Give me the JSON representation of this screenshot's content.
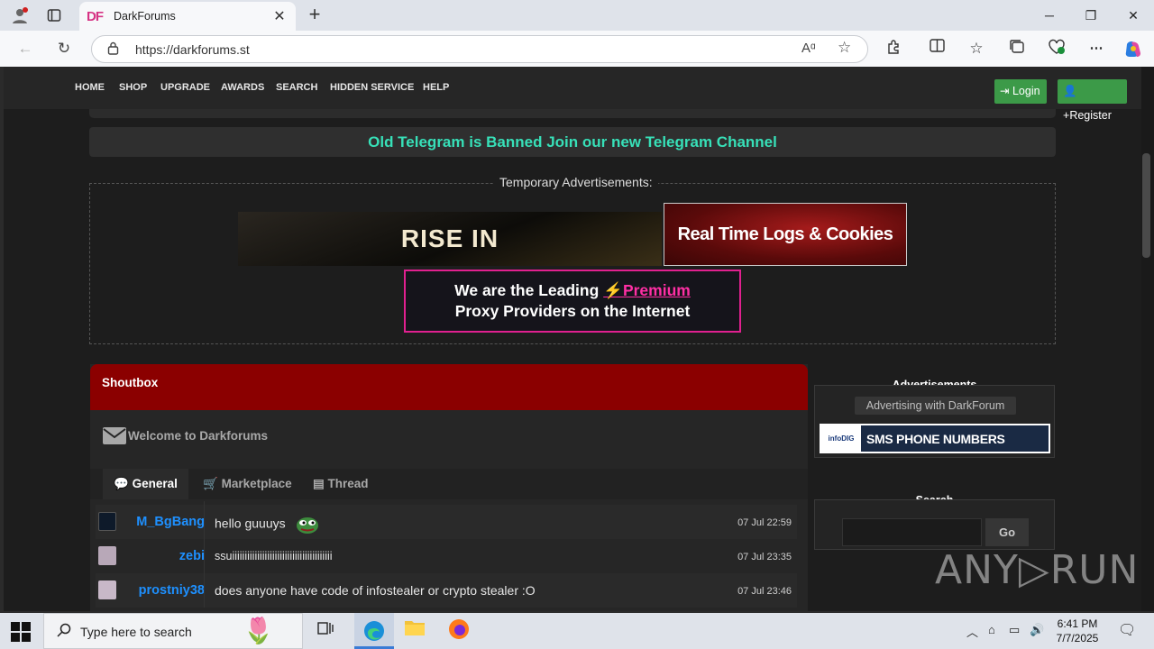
{
  "browser": {
    "tab_title": "DarkForums",
    "tab_favicon": "DF",
    "url": "https://darkforums.st",
    "read_aloud": "Aᵅ",
    "icons": [
      "profile-icon",
      "tab-actions-icon",
      "close-icon",
      "new-tab-icon",
      "back-icon",
      "refresh-icon",
      "lock-icon",
      "read-aloud-icon",
      "favorite-star-icon",
      "extensions-icon",
      "split-screen-icon",
      "favorites-icon",
      "collections-icon",
      "browser-essentials-icon",
      "more-icon",
      "copilot-icon"
    ]
  },
  "site": {
    "menu": [
      "HOME",
      "SHOP",
      "UPGRADE",
      "AWARDS",
      "SEARCH",
      "HIDDEN SERVICE",
      "HELP"
    ],
    "login_label": "Login",
    "register_label": "Register",
    "telegram_notice": "Old Telegram is Banned Join our new Telegram Channel",
    "ads_legend": "Temporary Advertisements:",
    "ad_rise": "RISE IN",
    "ad_logs": "Real Time Logs & Cookies",
    "ad_proxy_line1_a": "We are the Leading ",
    "ad_proxy_line1_b": "⚡Premium",
    "ad_proxy_line2": "Proxy Providers on the Internet",
    "accent_colors": {
      "telegram": "#37e0b8",
      "shoutbox_header": "#8b0000",
      "button_green": "#3c9a48",
      "username": "#1e90ff",
      "premium": "#ff2fa4"
    }
  },
  "shoutbox": {
    "title": "Shoutbox",
    "welcome": "Welcome to Darkforums",
    "tabs": [
      "General",
      "Marketplace",
      "Thread"
    ],
    "messages": [
      {
        "user": "M_BgBang",
        "text": "hello guuuys",
        "time": "07 Jul 22:59"
      },
      {
        "user": "zebi",
        "text": "ssuiiiiiiiiiiiiiiiiiiiiiiiiiiiiiiiiiiiiiiii",
        "time": "07 Jul 23:35"
      },
      {
        "user": "prostniy38",
        "text": "does anyone have code of infostealer or crypto stealer :O",
        "time": "07 Jul 23:46"
      }
    ]
  },
  "sidebar": {
    "ads_title": "Advertisements",
    "advertising_with": "Advertising with DarkForum",
    "sms_logo": "infoDIG",
    "sms_label": "SMS PHONE NUMBERS",
    "search_title": "Search",
    "search_button": "Go"
  },
  "watermark": "ANY▷RUN",
  "taskbar": {
    "search_placeholder": "Type here to search",
    "time": "6:41 PM",
    "date": "7/7/2025"
  }
}
